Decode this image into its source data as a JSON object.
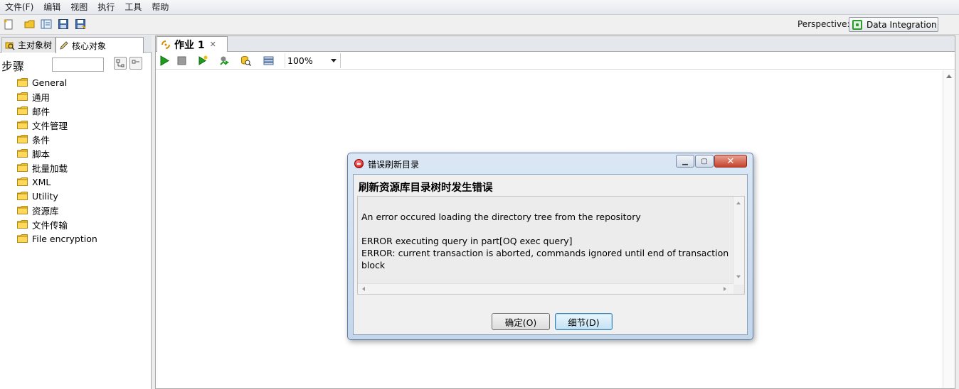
{
  "menu": [
    "文件(F)",
    "编辑",
    "视图",
    "执行",
    "工具",
    "帮助"
  ],
  "perspective": {
    "label": "Perspective:",
    "button_label": "Data Integration"
  },
  "left_panel": {
    "tabs": [
      "主对象树",
      "核心对象"
    ],
    "steps_label": "步骤",
    "search_value": "",
    "tree_items": [
      "General",
      "通用",
      "邮件",
      "文件管理",
      "条件",
      "脚本",
      "批量加载",
      "XML",
      "Utility",
      "资源库",
      "文件传输",
      "File encryption"
    ]
  },
  "job": {
    "tab_label": "作业 1",
    "zoom": "100%"
  },
  "dialog": {
    "title": "错误刷新目录",
    "heading": "刷新资源库目录树时发生错误",
    "message": "An error occured loading the directory tree from the repository\n\nERROR executing query in part[OQ exec query]\nERROR: current transaction is aborted, commands ignored until end of transaction block",
    "ok_label": "确定(O)",
    "details_label": "细节(D)"
  },
  "colors": {
    "folder": "#f4c430",
    "run_green": "#1e9e1e",
    "dialog_frame": "#c4d6ea"
  }
}
